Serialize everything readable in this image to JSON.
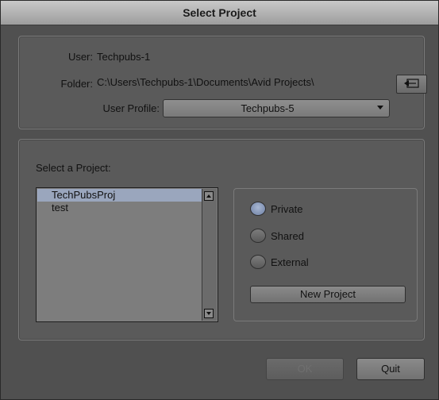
{
  "dialog": {
    "title": "Select Project"
  },
  "user_section": {
    "user_label": "User:",
    "user_value": "Techpubs-1",
    "folder_label": "Folder:",
    "folder_value": "C:\\Users\\Techpubs-1\\Documents\\Avid Projects\\",
    "profile_label": "User Profile:",
    "profile_value": "Techpubs-5"
  },
  "project_section": {
    "label": "Select a Project:",
    "projects": [
      "TechPubsProj",
      "test"
    ],
    "selected_index": 0,
    "radios": [
      {
        "label": "Private",
        "checked": true
      },
      {
        "label": "Shared",
        "checked": false
      },
      {
        "label": "External",
        "checked": false
      }
    ],
    "new_project_label": "New Project"
  },
  "buttons": {
    "ok_label": "OK",
    "quit_label": "Quit"
  },
  "icons": {
    "browse": "folder-browse-icon",
    "scroll_up": "scroll-up-icon",
    "scroll_down": "scroll-down-icon",
    "dropdown": "chevron-down-icon"
  }
}
